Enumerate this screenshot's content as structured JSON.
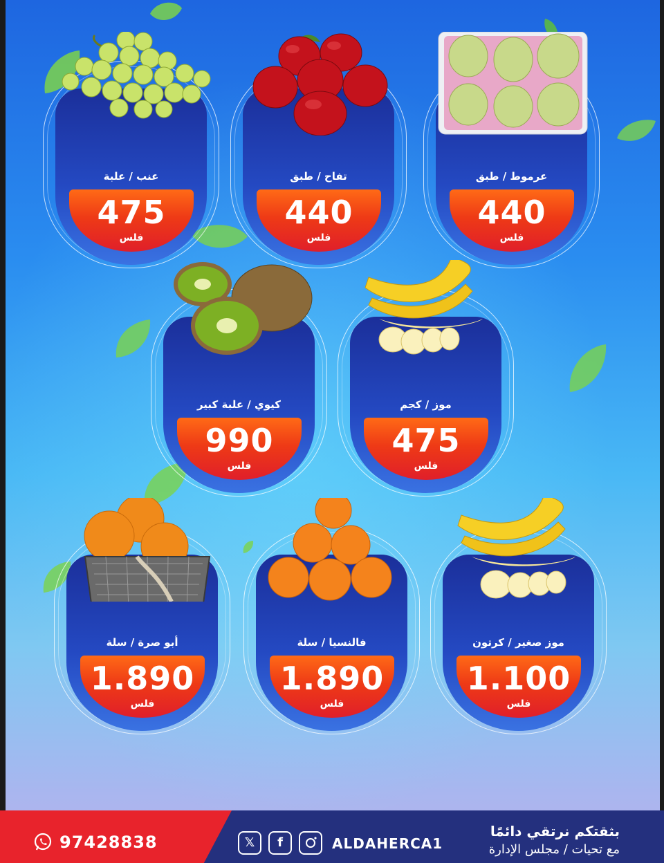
{
  "products": [
    {
      "label": "عنب / علبة",
      "price": "475",
      "currency": "فلس",
      "fruit": "grapes"
    },
    {
      "label": "تفاح / طبق",
      "price": "440",
      "currency": "فلس",
      "fruit": "apples"
    },
    {
      "label": "عرموط / طبق",
      "price": "440",
      "currency": "فلس",
      "fruit": "pears"
    },
    {
      "label": "كيوي / علبة كبير",
      "price": "990",
      "currency": "فلس",
      "fruit": "kiwi"
    },
    {
      "label": "موز / كجم",
      "price": "475",
      "currency": "فلس",
      "fruit": "banana"
    },
    {
      "label": "أبو صرة / سلة",
      "price": "1.890",
      "currency": "فلس",
      "fruit": "orange-basket"
    },
    {
      "label": "فالنسيا / سلة",
      "price": "1.890",
      "currency": "فلس",
      "fruit": "oranges"
    },
    {
      "label": "موز صغير / كرتون",
      "price": "1.100",
      "currency": "فلس",
      "fruit": "banana"
    }
  ],
  "footer": {
    "phone": "97428838",
    "social_handle": "ALDAHERCA1",
    "slogan_line1": "بثقتكم نرتقي دائمًا",
    "slogan_line2": "مع تحيات / مجلس الإدارة",
    "icons": [
      "whatsapp-icon",
      "x-icon",
      "facebook-icon",
      "instagram-icon"
    ]
  },
  "colors": {
    "price_red": "#e8232c",
    "price_orange": "#ff6a16",
    "panel_blue": "#1b2f9a",
    "footer_navy": "#24307e"
  }
}
